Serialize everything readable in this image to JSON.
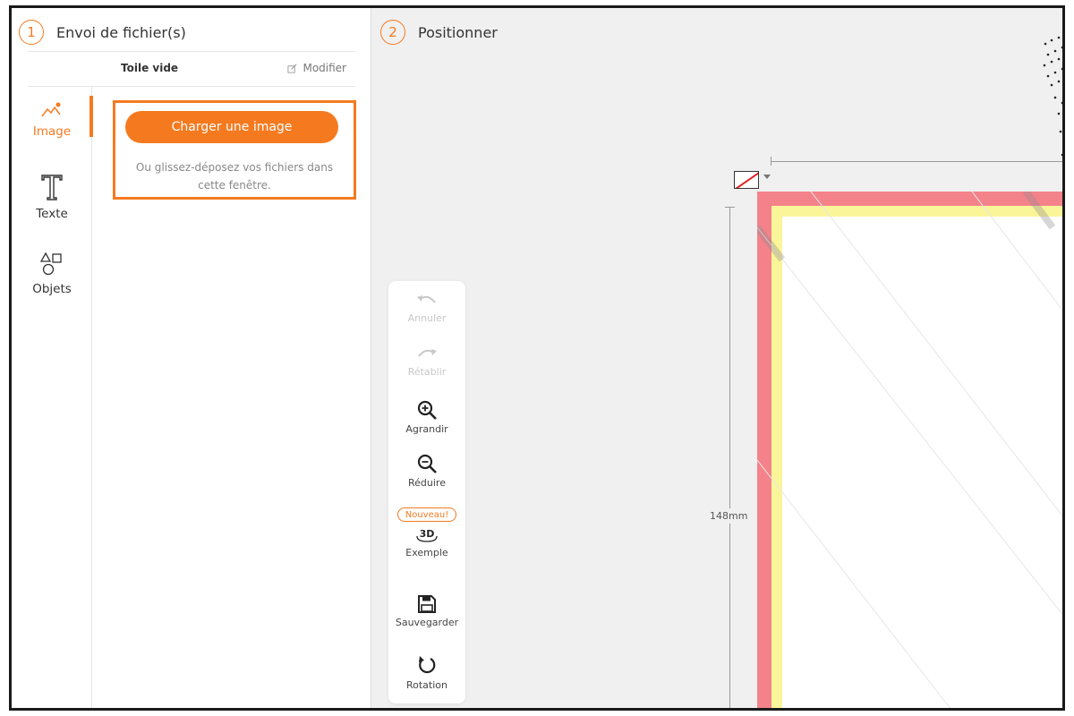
{
  "left_panel": {
    "step_number": "1",
    "step_title": "Envoi de fichier(s)",
    "subbar_title": "Toile vide",
    "modify_label": "Modifier",
    "tools": [
      {
        "label": "Image",
        "icon": "image-icon",
        "active": true
      },
      {
        "label": "Texte",
        "icon": "text-icon",
        "active": false
      },
      {
        "label": "Objets",
        "icon": "shapes-icon",
        "active": false
      }
    ],
    "upload_button": "Charger une image",
    "upload_hint_line1": "Ou glissez-déposez vos fichiers dans",
    "upload_hint_line2": "cette fenêtre."
  },
  "right_panel": {
    "step_number": "2",
    "step_title": "Positionner",
    "toolbar": [
      {
        "label": "Annuler",
        "icon": "undo-icon",
        "disabled": true
      },
      {
        "label": "Rétablir",
        "icon": "redo-icon",
        "disabled": true
      },
      {
        "label": "Agrandir",
        "icon": "zoom-in-icon",
        "disabled": false
      },
      {
        "label": "Réduire",
        "icon": "zoom-out-icon",
        "disabled": false
      },
      {
        "label": "Exemple",
        "icon": "3d-icon",
        "disabled": false,
        "badge": "Nouveau!"
      },
      {
        "label": "Sauvegarder",
        "icon": "save-icon",
        "disabled": false
      },
      {
        "label": "Rotation",
        "icon": "rotate-icon",
        "disabled": false
      }
    ],
    "icon_3d_text": "3D",
    "ruler_vertical_label": "148mm"
  },
  "colors": {
    "accent": "#f57a1f",
    "bleed": "#f4828a",
    "safe_zone": "#fbf59a"
  }
}
